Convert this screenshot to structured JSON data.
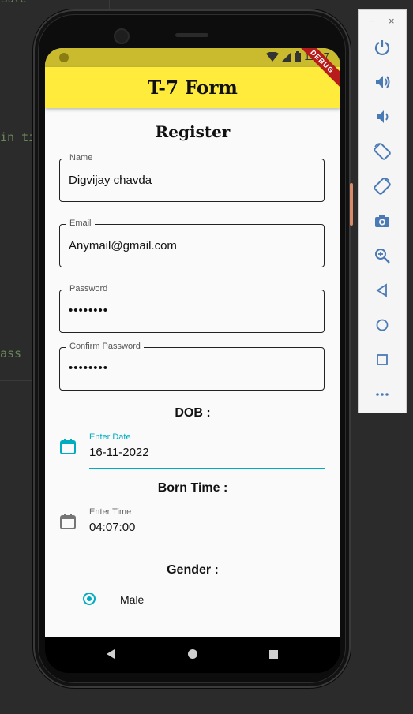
{
  "ide": {
    "code_fragment_1": "in ti",
    "code_fragment_2": "ass",
    "code_fragment_3": "sate"
  },
  "status_bar": {
    "time": "11:07",
    "debug_label": "DEBUG"
  },
  "app_bar": {
    "title": "T-7 Form"
  },
  "form": {
    "heading": "Register",
    "name": {
      "label": "Name",
      "value": "Digvijay chavda"
    },
    "email": {
      "label": "Email",
      "value": "Anymail@gmail.com"
    },
    "password": {
      "label": "Password",
      "value": "••••••••"
    },
    "confirm_password": {
      "label": "Confirm Password",
      "value": "••••••••"
    },
    "dob": {
      "section_title": "DOB :",
      "label": "Enter Date",
      "value": "16-11-2022"
    },
    "born_time": {
      "section_title": "Born Time :",
      "label": "Enter Time",
      "value": "04:07:00"
    },
    "gender": {
      "section_title": "Gender :",
      "options": [
        "Male"
      ],
      "selected": "Male"
    }
  },
  "colors": {
    "app_bar": "#ffeb3b",
    "status_bar": "#c9ba2e",
    "accent": "#00acc1",
    "debug_banner": "#b71c1c"
  },
  "emulator_toolbar": {
    "minimize": "−",
    "close": "×",
    "buttons": [
      "power-icon",
      "volume-up-icon",
      "volume-down-icon",
      "rotate-left-icon",
      "rotate-right-icon",
      "camera-icon",
      "zoom-icon",
      "back-icon",
      "home-icon",
      "overview-icon",
      "more-icon"
    ]
  }
}
